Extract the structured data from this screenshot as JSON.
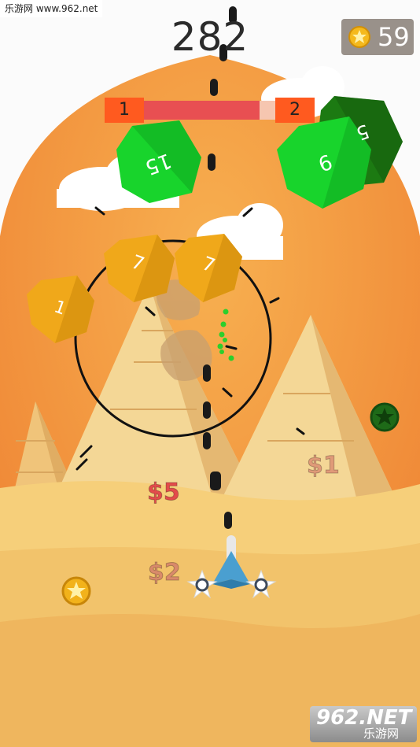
{
  "watermark_top": "乐游网 www.962.net",
  "score": "282",
  "coins": "59",
  "level": {
    "current": "1",
    "next": "2",
    "progress": 0.88
  },
  "blocks": [
    {
      "value": "15",
      "color": "#16d42b"
    },
    {
      "value": "9",
      "color": "#16d42b"
    },
    {
      "value": "5",
      "color": "#1f8a13"
    },
    {
      "value": "7",
      "color": "#f0a81a"
    },
    {
      "value": "7",
      "color": "#f0a81a"
    },
    {
      "value": "1",
      "color": "#f0a81a"
    }
  ],
  "money_labels": [
    "$5",
    "$2",
    "$1"
  ],
  "watermark_bottom": {
    "brand": "962.NET",
    "text": "乐游网"
  },
  "colors": {
    "sky": "#f08a3a",
    "sand": "#f2c46b",
    "pyramid": "#f3d08a",
    "money": "#e05050"
  }
}
